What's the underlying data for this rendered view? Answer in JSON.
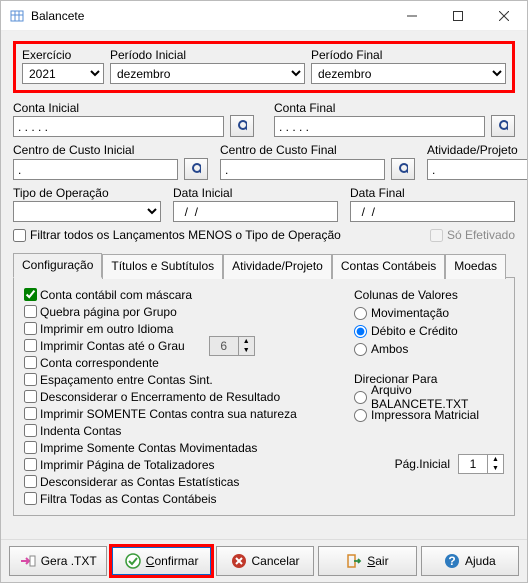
{
  "window": {
    "title": "Balancete"
  },
  "top": {
    "exercicio": {
      "label": "Exercício",
      "value": "2021"
    },
    "periodo_inicial": {
      "label": "Período Inicial",
      "value": "dezembro"
    },
    "periodo_final": {
      "label": "Período Final",
      "value": "dezembro"
    }
  },
  "conta_inicial": {
    "label": "Conta Inicial",
    "value": ". . . . ."
  },
  "conta_final": {
    "label": "Conta Final",
    "value": ". . . . ."
  },
  "centro_inicial": {
    "label": "Centro de Custo Inicial",
    "value": "."
  },
  "centro_final": {
    "label": "Centro de Custo Final",
    "value": "."
  },
  "atividade_projeto": {
    "label": "Atividade/Projeto",
    "value": "."
  },
  "tipo_operacao": {
    "label": "Tipo de Operação",
    "value": ""
  },
  "data_inicial": {
    "label": "Data Inicial",
    "value": "  /  /"
  },
  "data_final": {
    "label": "Data Final",
    "value": "  /  /"
  },
  "filtrar_menos": "Filtrar todos os Lançamentos  MENOS o Tipo de Operação",
  "so_efetivado": "Só Efetivado",
  "tabs": {
    "configuracao": "Configuração",
    "titulos": "Títulos e Subtítulos",
    "ativ": "Atividade/Projeto",
    "contas": "Contas Contábeis",
    "moedas": "Moedas"
  },
  "checks": {
    "c1": "Conta contábil com máscara",
    "c2": "Quebra página por Grupo",
    "c3": "Imprimir em outro Idioma",
    "c4": "Imprimir Contas até o Grau",
    "c4_val": "6",
    "c5": "Conta correspondente",
    "c6": "Espaçamento entre Contas Sint.",
    "c7": "Desconsiderar o Encerramento de Resultado",
    "c8": "Imprimir SOMENTE Contas contra sua natureza",
    "c9": "Indenta Contas",
    "c10": "Imprime Somente Contas Movimentadas",
    "c11": "Imprimir Página de Totalizadores",
    "c12": "Desconsiderar as Contas Estatísticas",
    "c13": "Filtra Todas as Contas Contábeis"
  },
  "colunas": {
    "title": "Colunas de Valores",
    "o1": "Movimentação",
    "o2": "Débito e Crédito",
    "o3": "Ambos"
  },
  "direcionar": {
    "title": "Direcionar  Para",
    "o1": "Arquivo BALANCETE.TXT",
    "o2": "Impressora Matricial"
  },
  "pag_inicial": {
    "label": "Pág.Inicial",
    "value": "1"
  },
  "footer": {
    "gera": "Gera .TXT",
    "confirmar": "Confirmar",
    "cancelar": "Cancelar",
    "sair": "Sair",
    "ajuda": "Ajuda"
  }
}
